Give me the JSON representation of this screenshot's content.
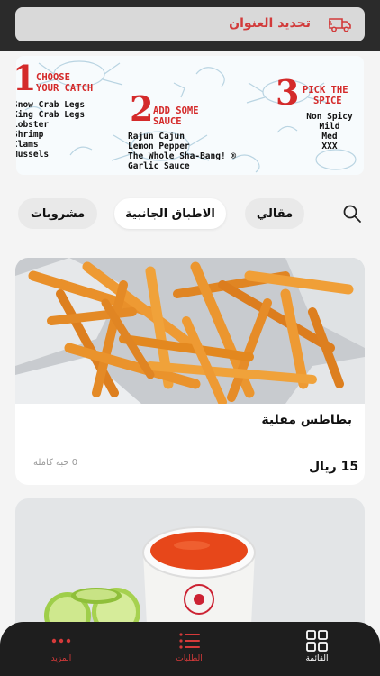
{
  "header": {
    "address_label": "تحديد العنوان",
    "truck_icon": "delivery-truck-icon"
  },
  "banner": {
    "step1": {
      "number": "1",
      "title_line1": "choose",
      "title_line2": "your catch",
      "items": [
        "Snow Crab Legs",
        "King Crab Legs",
        "Lobster",
        "Shrimp",
        "Clams",
        "Mussels"
      ]
    },
    "step2": {
      "number": "2",
      "title_line1": "ADD SOME",
      "title_line2": "SAUCE",
      "items": [
        "Rajun Cajun",
        "Lemon Pepper",
        "The Whole Sha-Bang! ®",
        "Garlic Sauce"
      ]
    },
    "step3": {
      "number": "3",
      "title_line1": "PICK THE",
      "title_line2": "SPICE",
      "items": [
        "Non Spicy",
        "Mild",
        "Med",
        "XXX"
      ]
    }
  },
  "categories": {
    "items": [
      "مقالي",
      "الاطباق الجانبية",
      "مشروبات"
    ],
    "active_index": 1
  },
  "menu": {
    "items": [
      {
        "name": "بطاطس مقلية",
        "price": "15 ريال",
        "qty": "0 حبة كاملة"
      },
      {
        "name": "",
        "price": "",
        "qty": ""
      }
    ]
  },
  "nav": {
    "items": [
      {
        "label": "القائمة",
        "icon": "grid-icon",
        "active": true
      },
      {
        "label": "الطلبات",
        "icon": "list-icon",
        "active": false
      },
      {
        "label": "المزيد",
        "icon": "more-dots-icon",
        "active": false
      }
    ]
  },
  "colors": {
    "accent": "#d42a2a",
    "dark": "#1e1e1e"
  }
}
